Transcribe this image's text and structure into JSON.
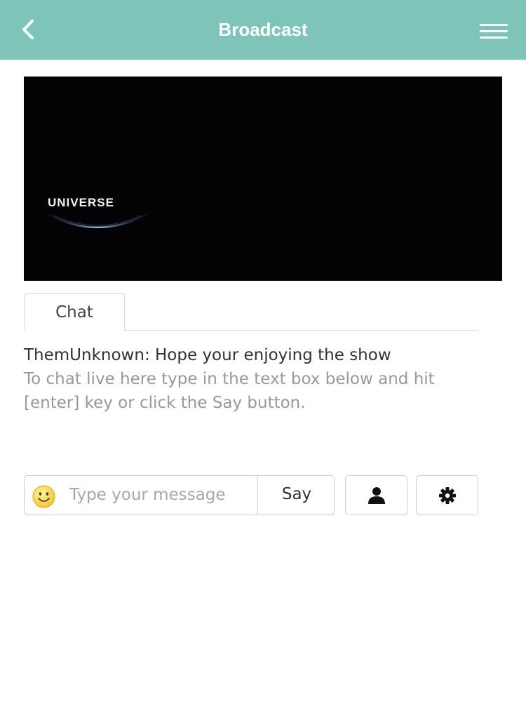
{
  "header": {
    "title": "Broadcast",
    "back_icon": "chevron-left-icon",
    "menu_icon": "hamburger-menu-icon",
    "background_color": "#7fc4b8"
  },
  "video": {
    "logo_text": "UNIVERSE",
    "background_color": "#040205"
  },
  "tabs": [
    {
      "label": "Chat",
      "active": true
    }
  ],
  "chat": {
    "messages": [
      {
        "user": "ThemUnknown",
        "text": "ThemUnknown: Hope your enjoying the show"
      }
    ],
    "hint": "To chat live here type in the text box below and hit [enter] key or click the Say button."
  },
  "composer": {
    "emoji_icon": "smiley-icon",
    "placeholder": "Type your message",
    "value": "",
    "say_label": "Say",
    "user_icon": "user-icon",
    "settings_icon": "gear-icon"
  }
}
